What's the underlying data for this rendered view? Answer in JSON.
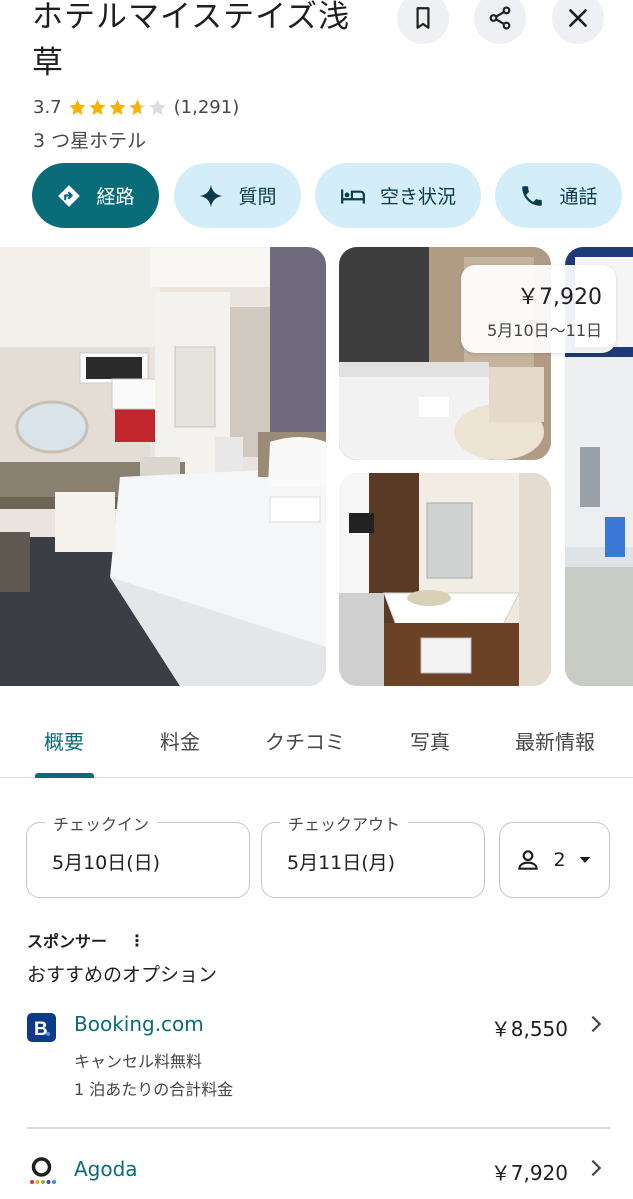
{
  "header": {
    "title": "ホテルマイステイズ浅草",
    "rating_value": "3.7",
    "rating_stars": 3.7,
    "review_count": "(1,291)",
    "category": "3 つ星ホテル",
    "icons": [
      "bookmark-icon",
      "share-icon",
      "close-icon"
    ]
  },
  "actions": [
    {
      "label": "経路",
      "icon": "directions-icon"
    },
    {
      "label": "質問",
      "icon": "sparkle-icon"
    },
    {
      "label": "空き状況",
      "icon": "bed-icon"
    },
    {
      "label": "通話",
      "icon": "phone-icon"
    }
  ],
  "photos": {
    "price": "￥7,920",
    "dates": "5月10日～11日"
  },
  "tabs": [
    "概要",
    "料金",
    "クチコミ",
    "写真",
    "最新情報"
  ],
  "booking": {
    "checkin_label": "チェックイン",
    "checkin_value": "5月10日(日)",
    "checkout_label": "チェックアウト",
    "checkout_value": "5月11日(月)",
    "guests": "2"
  },
  "sponsored": {
    "label": "スポンサー",
    "heading": "おすすめのオプション",
    "providers": [
      {
        "name": "Booking.com",
        "price": "￥8,550",
        "notes": [
          "キャンセル料無料",
          "1 泊あたりの合計料金"
        ]
      },
      {
        "name": "Agoda",
        "price": "￥7,920"
      }
    ]
  },
  "colors": {
    "accent": "#0b6c79",
    "chip": "#d3eef8",
    "star": "#f5b400"
  }
}
